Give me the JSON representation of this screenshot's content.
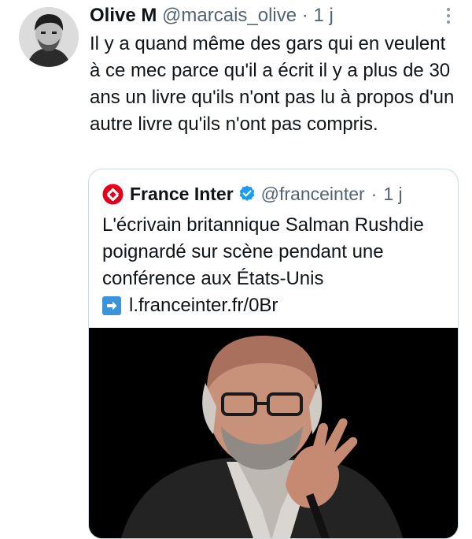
{
  "tweet": {
    "author_name": "Olive M",
    "author_handle": "@marcais_olive",
    "separator": "·",
    "time": "1 j",
    "text": "Il y a quand même des gars qui en veulent à ce mec parce qu'il a écrit il y a plus de 30 ans un livre qu'ils n'ont pas lu à propos d'un autre livre qu'ils n'ont pas compris.",
    "more_icon": "more-dots-icon"
  },
  "quoted": {
    "author_name": "France Inter",
    "author_handle": "@franceinter",
    "separator": "·",
    "time": "1 j",
    "verified": true,
    "verified_color": "#1d9bf0",
    "logo_color": "#e2001a",
    "text": "L'écrivain britannique Salman Rushdie poignardé sur scène pendant une conférence aux États-Unis",
    "link_icon": "right-arrow-emoji-icon",
    "link_text": "l.franceinter.fr/0Br"
  }
}
